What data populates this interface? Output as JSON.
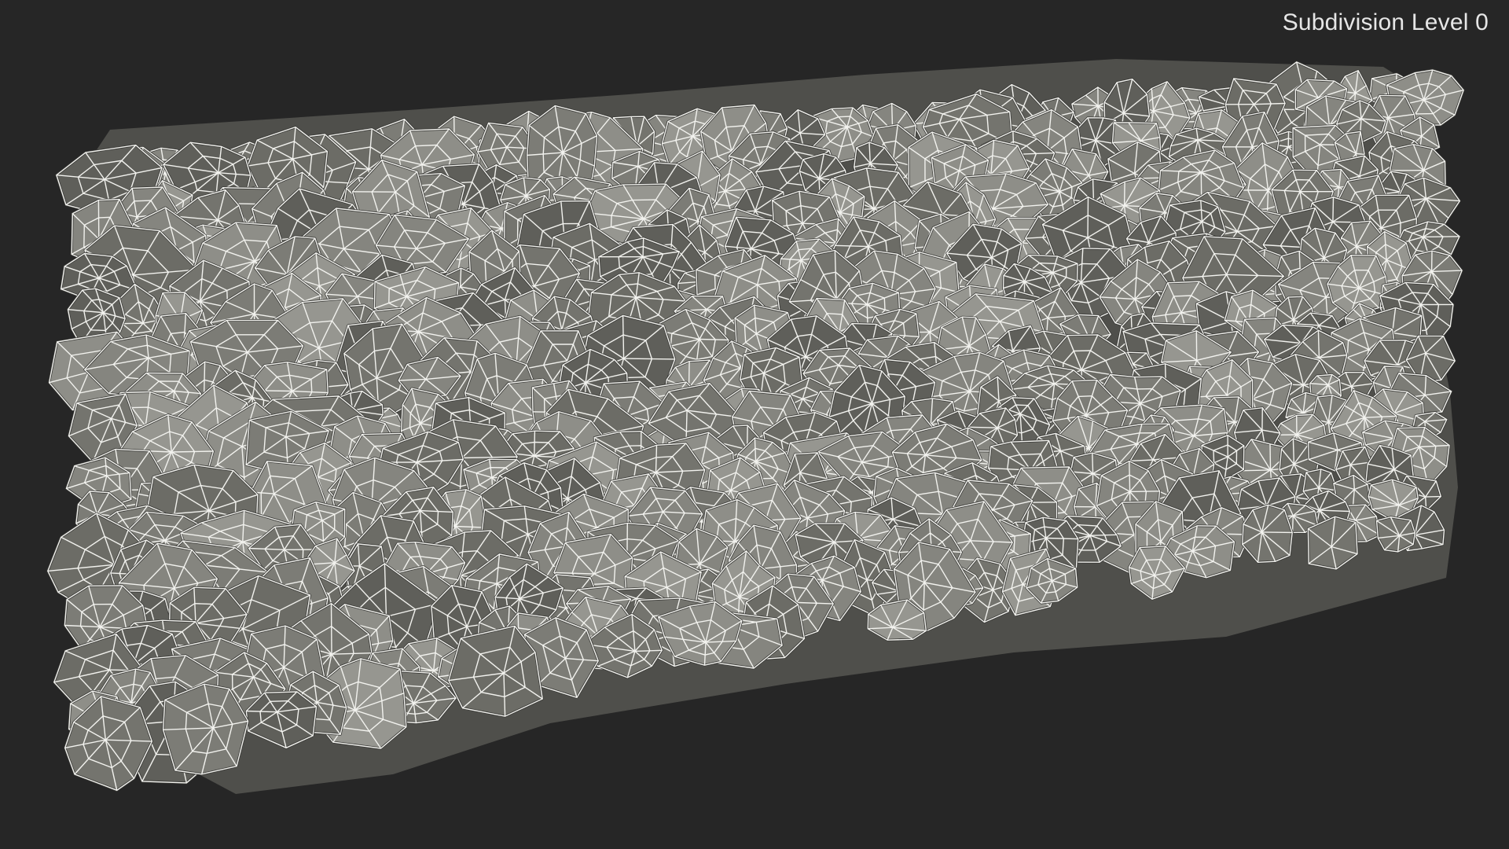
{
  "viewport": {
    "label": "Subdivision Level 0",
    "background_color": "#262626"
  },
  "model": {
    "subject": "stone-wall",
    "shading_colors": [
      "#6c6c66",
      "#74746e",
      "#7c7c76",
      "#85857f",
      "#8e8e88",
      "#969690",
      "#5f5f5a"
    ],
    "outline_color": "#3a3a37",
    "wireframe_color": "#f2f2ee"
  }
}
